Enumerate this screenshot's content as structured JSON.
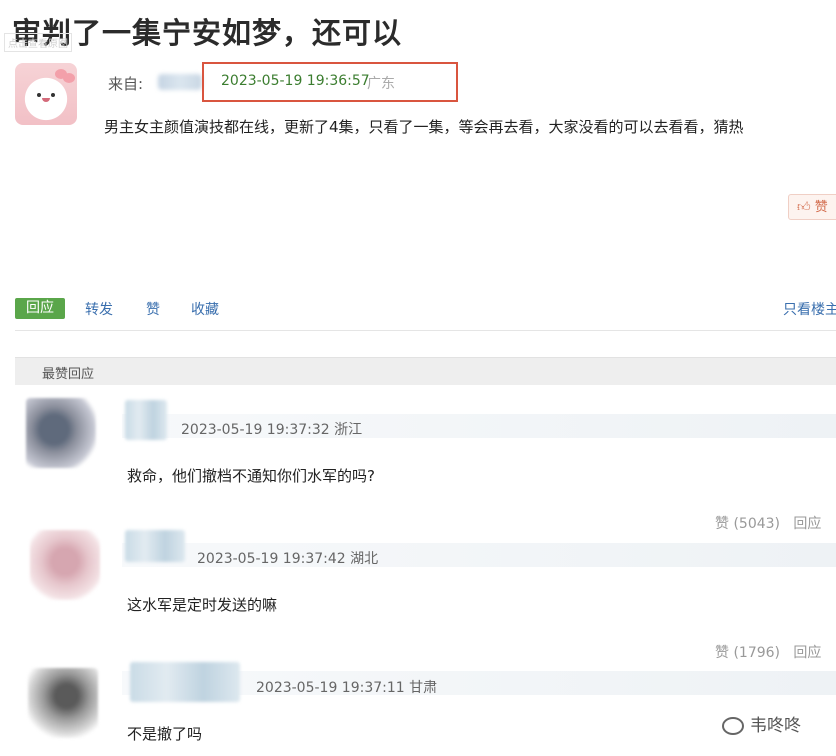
{
  "title": "审判了一集宁安如梦，还可以",
  "top_watermark": "点击查看原图",
  "post": {
    "from_label": "来自:",
    "time": "2023-05-19 19:36:57",
    "location": "广东",
    "text": "男主女主颜值演技都在线，更新了4集，只看了一集，等会再去看，大家没看的可以去看看，猜热",
    "like_label": "赞"
  },
  "actions": {
    "reply": "回应",
    "forward": "转发",
    "like": "赞",
    "favorite": "收藏",
    "only_op": "只看楼主"
  },
  "top_replies": {
    "section_label": "最赞回应",
    "items": [
      {
        "time": "2023-05-19 19:37:32 浙江",
        "text": "救命，他们撤档不通知你们水军的吗?",
        "likes": "赞 (5043)",
        "reply": "回应"
      },
      {
        "time": "2023-05-19 19:37:42 湖北",
        "text": "这水军是定时发送的嘛",
        "likes": "赞 (1796)",
        "reply": "回应"
      },
      {
        "time": "2023-05-19 19:37:11 甘肃",
        "text": "不是撤了吗"
      }
    ]
  },
  "watermark": "韦咚咚",
  "colors": {
    "highlight_box": "#d9553f",
    "green": "#5aa64a",
    "link": "#3a6fae"
  }
}
